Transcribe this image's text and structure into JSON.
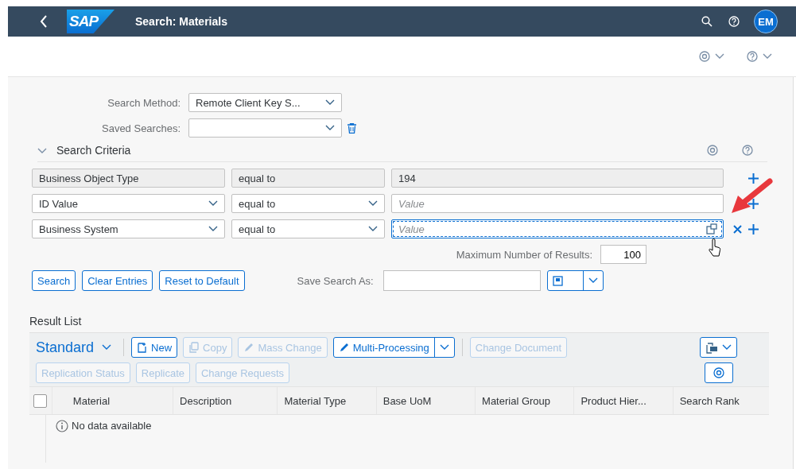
{
  "header": {
    "logo": "SAP",
    "title": "Search: Materials",
    "avatar": "EM"
  },
  "search_method": {
    "label": "Search Method:",
    "value": "Remote Client Key S..."
  },
  "saved_searches": {
    "label": "Saved Searches:"
  },
  "criteria": {
    "title": "Search Criteria",
    "expanded": true,
    "rows": [
      {
        "field": "Business Object Type",
        "operator": "equal to",
        "value": "194",
        "disabled": true,
        "removable": false,
        "focused": false
      },
      {
        "field": "ID Value",
        "operator": "equal to",
        "placeholder": "Value",
        "disabled": false,
        "removable": false,
        "focused": false
      },
      {
        "field": "Business System",
        "operator": "equal to",
        "placeholder": "Value",
        "disabled": false,
        "removable": true,
        "focused": true
      }
    ]
  },
  "max_results": {
    "label": "Maximum Number of Results:",
    "value": "100"
  },
  "buttons": [
    "Search",
    "Clear Entries",
    "Reset to Default"
  ],
  "save_search_as": {
    "label": "Save Search As:"
  },
  "result_list": {
    "title": "Result List",
    "variant": "Standard",
    "toolbar_rows": [
      [
        {
          "label": "New",
          "kind": "button",
          "disabled": false
        },
        {
          "label": "Copy",
          "kind": "button",
          "disabled": true
        },
        {
          "label": "Mass Change",
          "kind": "button",
          "disabled": true
        },
        {
          "label": "Multi-Processing",
          "kind": "split",
          "disabled": false
        },
        {
          "label": "Change Document",
          "kind": "separated",
          "disabled": true
        }
      ],
      [
        {
          "label": "Replication Status",
          "kind": "button",
          "disabled": true
        },
        {
          "label": "Replicate",
          "kind": "button",
          "disabled": true
        },
        {
          "label": "Change Requests",
          "kind": "button",
          "disabled": true
        }
      ]
    ],
    "select_all_checked": false,
    "columns": [
      "Material",
      "Description",
      "Material Type",
      "Base UoM",
      "Material Group",
      "Product Hier...",
      "Search Rank"
    ],
    "empty_text": "No data available"
  }
}
